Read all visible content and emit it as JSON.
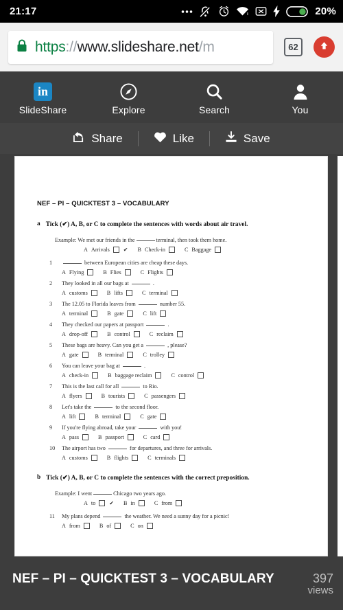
{
  "status_bar": {
    "clock": "21:17",
    "battery_percent": "20%",
    "icons": [
      "more-dots-icon",
      "mute-vibrate-icon",
      "alarm-icon",
      "wifi-icon",
      "no-sim-icon",
      "charging-bolt-icon",
      "battery-icon"
    ]
  },
  "browser": {
    "url_scheme": "https",
    "url_separator": "://",
    "url_host": "www.slideshare.net",
    "url_path": "/m",
    "url_full": "https://www.slideshare.net/m",
    "tab_count": "62",
    "upload_icon": "upload-arrow-icon",
    "lock_icon": "lock-icon"
  },
  "nav": {
    "items": [
      {
        "label": "SlideShare",
        "icon": "linkedin-logo-icon",
        "glyph": "in"
      },
      {
        "label": "Explore",
        "icon": "compass-icon"
      },
      {
        "label": "Search",
        "icon": "search-icon"
      },
      {
        "label": "You",
        "icon": "person-icon"
      }
    ]
  },
  "actions": [
    {
      "label": "Share",
      "icon": "share-icon"
    },
    {
      "label": "Like",
      "icon": "heart-icon"
    },
    {
      "label": "Save",
      "icon": "download-icon"
    }
  ],
  "slide": {
    "title": "NEF – PI – QUICKTEST 3 – VOCABULARY",
    "sections": [
      {
        "letter": "a",
        "instruction": "Tick (✔) A, B, or C to complete the sentences with words about air travel.",
        "example": {
          "label": "Example:",
          "text_before": "We met our friends in the",
          "text_after": "terminal, then took them home.",
          "options": [
            {
              "letter": "A",
              "text": "Arrivals",
              "ticked": true
            },
            {
              "letter": "B",
              "text": "Check-in",
              "ticked": false
            },
            {
              "letter": "C",
              "text": "Baggage",
              "ticked": false
            }
          ]
        },
        "questions": [
          {
            "num": "1",
            "text_before": "",
            "text_after": "between European cities are cheap these days.",
            "options": [
              {
                "letter": "A",
                "text": "Flying"
              },
              {
                "letter": "B",
                "text": "Flies"
              },
              {
                "letter": "C",
                "text": "Flights"
              }
            ]
          },
          {
            "num": "2",
            "text_before": "They looked in all our bags at",
            "text_after": ".",
            "options": [
              {
                "letter": "A",
                "text": "customs"
              },
              {
                "letter": "B",
                "text": "lifts"
              },
              {
                "letter": "C",
                "text": "terminal"
              }
            ]
          },
          {
            "num": "3",
            "text_before": "The 12.05 to Florida leaves from",
            "text_after": "number 55.",
            "options": [
              {
                "letter": "A",
                "text": "terminal"
              },
              {
                "letter": "B",
                "text": "gate"
              },
              {
                "letter": "C",
                "text": "lift"
              }
            ]
          },
          {
            "num": "4",
            "text_before": "They checked our papers at passport",
            "text_after": ".",
            "options": [
              {
                "letter": "A",
                "text": "drop-off"
              },
              {
                "letter": "B",
                "text": "control"
              },
              {
                "letter": "C",
                "text": "reclaim"
              }
            ]
          },
          {
            "num": "5",
            "text_before": "These bags are heavy. Can you get a",
            "text_after": ", please?",
            "options": [
              {
                "letter": "A",
                "text": "gate"
              },
              {
                "letter": "B",
                "text": "terminal"
              },
              {
                "letter": "C",
                "text": "trolley"
              }
            ]
          },
          {
            "num": "6",
            "text_before": "You can leave your bag at",
            "text_after": ".",
            "options": [
              {
                "letter": "A",
                "text": "check-in"
              },
              {
                "letter": "B",
                "text": "baggage reclaim"
              },
              {
                "letter": "C",
                "text": "control"
              }
            ]
          },
          {
            "num": "7",
            "text_before": "This is the last call for all",
            "text_after": "to Rio.",
            "options": [
              {
                "letter": "A",
                "text": "flyers"
              },
              {
                "letter": "B",
                "text": "tourists"
              },
              {
                "letter": "C",
                "text": "passengers"
              }
            ]
          },
          {
            "num": "8",
            "text_before": "Let's take the",
            "text_after": "to the second floor.",
            "options": [
              {
                "letter": "A",
                "text": "lift"
              },
              {
                "letter": "B",
                "text": "terminal"
              },
              {
                "letter": "C",
                "text": "gate"
              }
            ]
          },
          {
            "num": "9",
            "text_before": "If you're flying abroad, take your",
            "text_after": "with you!",
            "options": [
              {
                "letter": "A",
                "text": "pass"
              },
              {
                "letter": "B",
                "text": "passport"
              },
              {
                "letter": "C",
                "text": "card"
              }
            ]
          },
          {
            "num": "10",
            "text_before": "The airport has two",
            "text_after": "for departures, and three for arrivals.",
            "options": [
              {
                "letter": "A",
                "text": "customs"
              },
              {
                "letter": "B",
                "text": "flights"
              },
              {
                "letter": "C",
                "text": "terminals"
              }
            ]
          }
        ]
      },
      {
        "letter": "b",
        "instruction": "Tick (✔) A, B, or C to complete the sentences with the correct preposition.",
        "example": {
          "label": "Example:",
          "text_before": "I went",
          "text_after": "Chicago two years ago.",
          "options": [
            {
              "letter": "A",
              "text": "to",
              "ticked": true
            },
            {
              "letter": "B",
              "text": "in",
              "ticked": false
            },
            {
              "letter": "C",
              "text": "from",
              "ticked": false
            }
          ]
        },
        "questions": [
          {
            "num": "11",
            "text_before": "My plans depend",
            "text_after": "the weather. We need a sunny day for a picnic!",
            "options": [
              {
                "letter": "A",
                "text": "from"
              },
              {
                "letter": "B",
                "text": "of"
              },
              {
                "letter": "C",
                "text": "on"
              }
            ]
          }
        ]
      }
    ]
  },
  "footer": {
    "title": "NEF – PI – QUICKTEST 3 – VOCABULARY",
    "views_count": "397",
    "views_label": "views"
  },
  "colors": {
    "chrome_dark": "#3d3d3d",
    "actionbar": "#434343",
    "linkedin_blue": "#1b86c4",
    "upload_red": "#d93d30",
    "lock_green": "#0b8043",
    "battery_green": "#4caf50"
  }
}
